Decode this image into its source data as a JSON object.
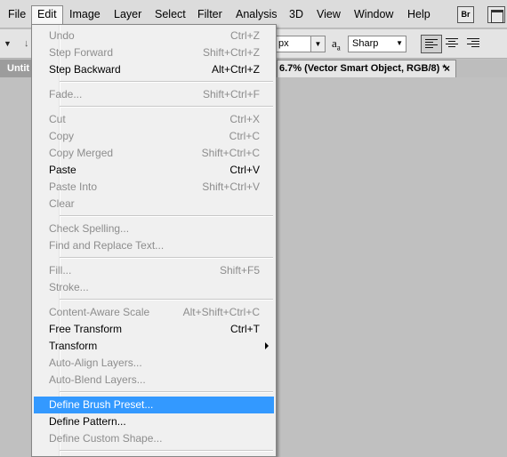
{
  "menubar": {
    "items": [
      "File",
      "Edit",
      "Image",
      "Layer",
      "Select",
      "Filter",
      "Analysis",
      "3D",
      "View",
      "Window",
      "Help"
    ],
    "bridge_label": "Br"
  },
  "options": {
    "size_unit": "px",
    "aa_icon": "a",
    "aa_icon_sub": "a",
    "antialias": "Sharp"
  },
  "tabs": {
    "left_label": "Untit",
    "doc_label": "6.7% (Vector Smart Object, RGB/8) *",
    "close": "×"
  },
  "edit_menu": {
    "items": [
      {
        "label": "Undo",
        "shortcut": "Ctrl+Z",
        "disabled": true
      },
      {
        "label": "Step Forward",
        "shortcut": "Shift+Ctrl+Z",
        "disabled": true
      },
      {
        "label": "Step Backward",
        "shortcut": "Alt+Ctrl+Z",
        "disabled": false
      },
      {
        "label": "Fade...",
        "shortcut": "Shift+Ctrl+F",
        "disabled": true
      },
      {
        "label": "Cut",
        "shortcut": "Ctrl+X",
        "disabled": true
      },
      {
        "label": "Copy",
        "shortcut": "Ctrl+C",
        "disabled": true
      },
      {
        "label": "Copy Merged",
        "shortcut": "Shift+Ctrl+C",
        "disabled": true
      },
      {
        "label": "Paste",
        "shortcut": "Ctrl+V",
        "disabled": false
      },
      {
        "label": "Paste Into",
        "shortcut": "Shift+Ctrl+V",
        "disabled": true
      },
      {
        "label": "Clear",
        "shortcut": "",
        "disabled": true
      },
      {
        "label": "Check Spelling...",
        "shortcut": "",
        "disabled": true
      },
      {
        "label": "Find and Replace Text...",
        "shortcut": "",
        "disabled": true
      },
      {
        "label": "Fill...",
        "shortcut": "Shift+F5",
        "disabled": true
      },
      {
        "label": "Stroke...",
        "shortcut": "",
        "disabled": true
      },
      {
        "label": "Content-Aware Scale",
        "shortcut": "Alt+Shift+Ctrl+C",
        "disabled": true
      },
      {
        "label": "Free Transform",
        "shortcut": "Ctrl+T",
        "disabled": false
      },
      {
        "label": "Transform",
        "shortcut": "",
        "disabled": false,
        "submenu": true
      },
      {
        "label": "Auto-Align Layers...",
        "shortcut": "",
        "disabled": true
      },
      {
        "label": "Auto-Blend Layers...",
        "shortcut": "",
        "disabled": true
      },
      {
        "label": "Define Brush Preset...",
        "shortcut": "",
        "disabled": false,
        "highlighted": true
      },
      {
        "label": "Define Pattern...",
        "shortcut": "",
        "disabled": false
      },
      {
        "label": "Define Custom Shape...",
        "shortcut": "",
        "disabled": true
      }
    ]
  },
  "colors": {
    "highlight": "#3399ff",
    "disabled_text": "#8d8d8d",
    "canvas": "#c0c0c0"
  }
}
